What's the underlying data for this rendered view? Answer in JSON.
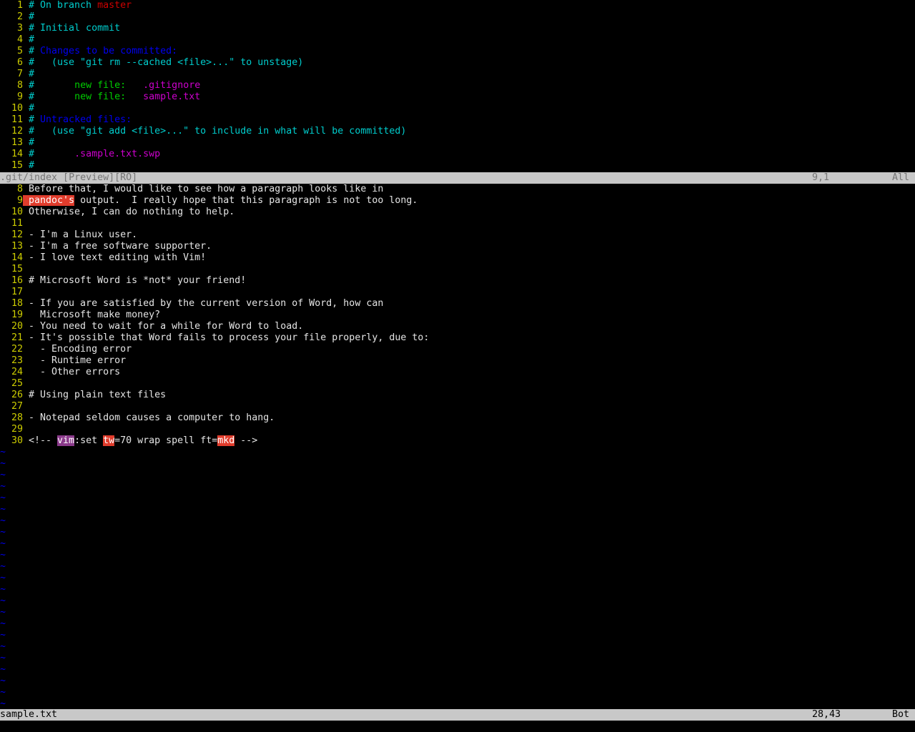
{
  "terminal": {
    "cols": 160,
    "rows": 64,
    "background": "#000000",
    "foreground": "#e5e5e5"
  },
  "windows": [
    {
      "id": "preview-window",
      "buffer_name": ".git/index",
      "lines": [
        {
          "number": "1",
          "spans": [
            {
              "t": "# On branch ",
              "c": "cyan"
            },
            {
              "t": "master",
              "c": "red"
            }
          ]
        },
        {
          "number": "2",
          "spans": [
            {
              "t": "#",
              "c": "cyan"
            }
          ]
        },
        {
          "number": "3",
          "spans": [
            {
              "t": "# Initial commit",
              "c": "cyan"
            }
          ]
        },
        {
          "number": "4",
          "spans": [
            {
              "t": "#",
              "c": "cyan"
            }
          ]
        },
        {
          "number": "5",
          "spans": [
            {
              "t": "# ",
              "c": "cyan"
            },
            {
              "t": "Changes to be committed:",
              "c": "blue"
            }
          ]
        },
        {
          "number": "6",
          "spans": [
            {
              "t": "#   (use \"git rm --cached <file>...\" to unstage)",
              "c": "cyan"
            }
          ]
        },
        {
          "number": "7",
          "spans": [
            {
              "t": "#",
              "c": "cyan"
            }
          ]
        },
        {
          "number": "8",
          "spans": [
            {
              "t": "#       ",
              "c": "cyan"
            },
            {
              "t": "new file:",
              "c": "green"
            },
            {
              "t": "   ",
              "c": "green"
            },
            {
              "t": ".gitignore",
              "c": "magenta"
            }
          ]
        },
        {
          "number": "9",
          "spans": [
            {
              "t": "#       ",
              "c": "cyan"
            },
            {
              "t": "new file:",
              "c": "green"
            },
            {
              "t": "   ",
              "c": "green"
            },
            {
              "t": "sample.txt",
              "c": "magenta"
            }
          ]
        },
        {
          "number": "10",
          "spans": [
            {
              "t": "#",
              "c": "cyan"
            }
          ]
        },
        {
          "number": "11",
          "spans": [
            {
              "t": "# ",
              "c": "cyan"
            },
            {
              "t": "Untracked files:",
              "c": "blue"
            }
          ]
        },
        {
          "number": "12",
          "spans": [
            {
              "t": "#   (use \"git add <file>...\" to include in what will be committed)",
              "c": "cyan"
            }
          ]
        },
        {
          "number": "13",
          "spans": [
            {
              "t": "#",
              "c": "cyan"
            }
          ]
        },
        {
          "number": "14",
          "spans": [
            {
              "t": "#       ",
              "c": "cyan"
            },
            {
              "t": ".sample.txt.swp",
              "c": "magenta"
            }
          ]
        },
        {
          "number": "15",
          "spans": [
            {
              "t": "#",
              "c": "cyan"
            }
          ]
        }
      ],
      "statusline": {
        "name": ".git/index [Preview][RO]",
        "ruler": "9,1",
        "percent": "All",
        "active": false
      }
    },
    {
      "id": "sample-window",
      "buffer_name": "sample.txt",
      "lines": [
        {
          "number": "8",
          "spans": [
            {
              "t": "Before that, I would like to see how a paragraph looks like in",
              "c": "white"
            }
          ]
        },
        {
          "number": "9",
          "spans": [
            {
              "t": "pandoc's",
              "c": "spell-bad"
            },
            {
              "t": " output.  I really hope that this paragraph is not too long.",
              "c": "white"
            }
          ]
        },
        {
          "number": "10",
          "spans": [
            {
              "t": "Otherwise, I can do nothing to help.",
              "c": "white"
            }
          ]
        },
        {
          "number": "11",
          "spans": [
            {
              "t": "",
              "c": "white"
            }
          ]
        },
        {
          "number": "12",
          "spans": [
            {
              "t": "- I'm a Linux user.",
              "c": "white"
            }
          ]
        },
        {
          "number": "13",
          "spans": [
            {
              "t": "- I'm a free software supporter.",
              "c": "white"
            }
          ]
        },
        {
          "number": "14",
          "spans": [
            {
              "t": "- I love text editing with Vim!",
              "c": "white"
            }
          ]
        },
        {
          "number": "15",
          "spans": [
            {
              "t": "",
              "c": "white"
            }
          ]
        },
        {
          "number": "16",
          "spans": [
            {
              "t": "# Microsoft Word is *not* your friend!",
              "c": "white"
            }
          ]
        },
        {
          "number": "17",
          "spans": [
            {
              "t": "",
              "c": "white"
            }
          ]
        },
        {
          "number": "18",
          "spans": [
            {
              "t": "- If you are satisfied by the current version of Word, how can",
              "c": "white"
            }
          ]
        },
        {
          "number": "19",
          "spans": [
            {
              "t": "  Microsoft make money?",
              "c": "white"
            }
          ]
        },
        {
          "number": "20",
          "spans": [
            {
              "t": "- You need to wait for a while for Word to load.",
              "c": "white"
            }
          ]
        },
        {
          "number": "21",
          "spans": [
            {
              "t": "- It's possible that Word fails to process your file properly, due to:",
              "c": "white"
            }
          ]
        },
        {
          "number": "22",
          "spans": [
            {
              "t": "  - Encoding error",
              "c": "white"
            }
          ]
        },
        {
          "number": "23",
          "spans": [
            {
              "t": "  - Runtime error",
              "c": "white"
            }
          ]
        },
        {
          "number": "24",
          "spans": [
            {
              "t": "  - Other errors",
              "c": "white"
            }
          ]
        },
        {
          "number": "25",
          "spans": [
            {
              "t": "",
              "c": "white"
            }
          ]
        },
        {
          "number": "26",
          "spans": [
            {
              "t": "# Using plain text files",
              "c": "white"
            }
          ]
        },
        {
          "number": "27",
          "spans": [
            {
              "t": "",
              "c": "white"
            }
          ]
        },
        {
          "number": "28",
          "spans": [
            {
              "t": "- Notepad seldom causes a computer to hang.",
              "c": "white"
            }
          ]
        },
        {
          "number": "29",
          "spans": [
            {
              "t": "",
              "c": "white"
            }
          ]
        },
        {
          "number": "30",
          "spans": [
            {
              "t": "<!-- ",
              "c": "white"
            },
            {
              "t": "vim",
              "c": "spell-rare"
            },
            {
              "t": ":set ",
              "c": "white"
            },
            {
              "t": "tw",
              "c": "spell-bad"
            },
            {
              "t": "=70 wrap spell ft=",
              "c": "white"
            },
            {
              "t": "mkd",
              "c": "spell-bad"
            },
            {
              "t": " -->",
              "c": "white"
            }
          ]
        }
      ],
      "filler_char": "~",
      "filler_count": 23,
      "statusline": {
        "name": "sample.txt",
        "ruler": "28,43",
        "percent": "Bot",
        "active": true
      }
    }
  ],
  "cmdline": {
    "text": ""
  }
}
